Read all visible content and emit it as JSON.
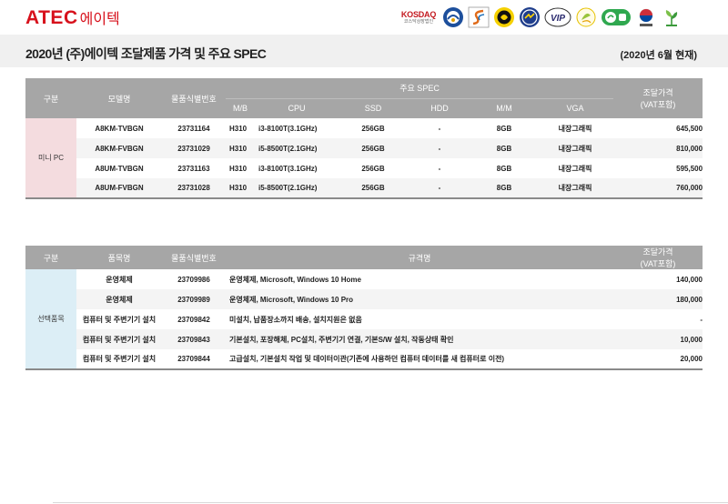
{
  "header": {
    "logo_main": "ATEC",
    "logo_sub": "에이텍",
    "kosdaq": "KOSDAQ",
    "kosdaq_sub": "코스닥상장법인"
  },
  "page": {
    "title": "2020년 (주)에이텍 조달제품 가격 및 주요 SPEC",
    "as_of": "(2020년 6월 현재)"
  },
  "table1": {
    "h_category": "구분",
    "h_model": "모델명",
    "h_id": "물품식별번호",
    "h_spec": "주요 SPEC",
    "h_mb": "M/B",
    "h_cpu": "CPU",
    "h_ssd": "SSD",
    "h_hdd": "HDD",
    "h_mm": "M/M",
    "h_vga": "VGA",
    "h_price_line1": "조달가격",
    "h_price_line2": "(VAT포함)",
    "category": "미니 PC",
    "rows": [
      {
        "model": "A8KM-TVBGN",
        "id": "23731164",
        "mb": "H310",
        "cpu": "i3-8100T(3.1GHz)",
        "ssd": "256GB",
        "hdd": "-",
        "mm": "8GB",
        "vga": "내장그래픽",
        "price": "645,500"
      },
      {
        "model": "A8KM-FVBGN",
        "id": "23731029",
        "mb": "H310",
        "cpu": "i5-8500T(2.1GHz)",
        "ssd": "256GB",
        "hdd": "-",
        "mm": "8GB",
        "vga": "내장그래픽",
        "price": "810,000"
      },
      {
        "model": "A8UM-TVBGN",
        "id": "23731163",
        "mb": "H310",
        "cpu": "i3-8100T(3.1GHz)",
        "ssd": "256GB",
        "hdd": "-",
        "mm": "8GB",
        "vga": "내장그래픽",
        "price": "595,500"
      },
      {
        "model": "A8UM-FVBGN",
        "id": "23731028",
        "mb": "H310",
        "cpu": "i5-8500T(2.1GHz)",
        "ssd": "256GB",
        "hdd": "-",
        "mm": "8GB",
        "vga": "내장그래픽",
        "price": "760,000"
      }
    ]
  },
  "table2": {
    "h_category": "구분",
    "h_item": "품목명",
    "h_id": "물품식별번호",
    "h_spec": "규격명",
    "h_price_line1": "조달가격",
    "h_price_line2": "(VAT포함)",
    "category": "선택품목",
    "rows": [
      {
        "item": "운영체제",
        "id": "23709986",
        "spec": "운영체제, Microsoft, Windows 10 Home",
        "price": "140,000"
      },
      {
        "item": "운영체제",
        "id": "23709989",
        "spec": "운영체제, Microsoft, Windows 10 Pro",
        "price": "180,000"
      },
      {
        "item": "컴퓨터 및 주변기기 설치",
        "id": "23709842",
        "spec": "미설치, 납품장소까지 배송, 설치지원은 없음",
        "price": "-"
      },
      {
        "item": "컴퓨터 및 주변기기 설치",
        "id": "23709843",
        "spec": "기본설치, 포장해체, PC설치, 주변기기 연결, 기본S/W 설치, 작동상태 확인",
        "price": "10,000"
      },
      {
        "item": "컴퓨터 및 주변기기 설치",
        "id": "23709844",
        "spec": "고급설치, 기본설치 작업 및 데이터이관(기존에 사용하던 컴퓨터 데이터를 새 컴퓨터로 이전)",
        "price": "20,000"
      }
    ]
  },
  "colors": {
    "brand": "#d7111c",
    "header_gray": "#a6a6a6",
    "cat_pink": "#f4dcdf",
    "cat_blue": "#dceef6"
  },
  "icons": [
    "kosdaq-logo",
    "cert-badge-blue-emblem",
    "cert-badge-s-curve",
    "cert-badge-yellow-black",
    "cert-badge-blue-globe",
    "cert-badge-vip",
    "cert-badge-green-leaf",
    "cert-badge-green-oval",
    "cert-badge-korea-flag",
    "cert-badge-green-plant"
  ]
}
